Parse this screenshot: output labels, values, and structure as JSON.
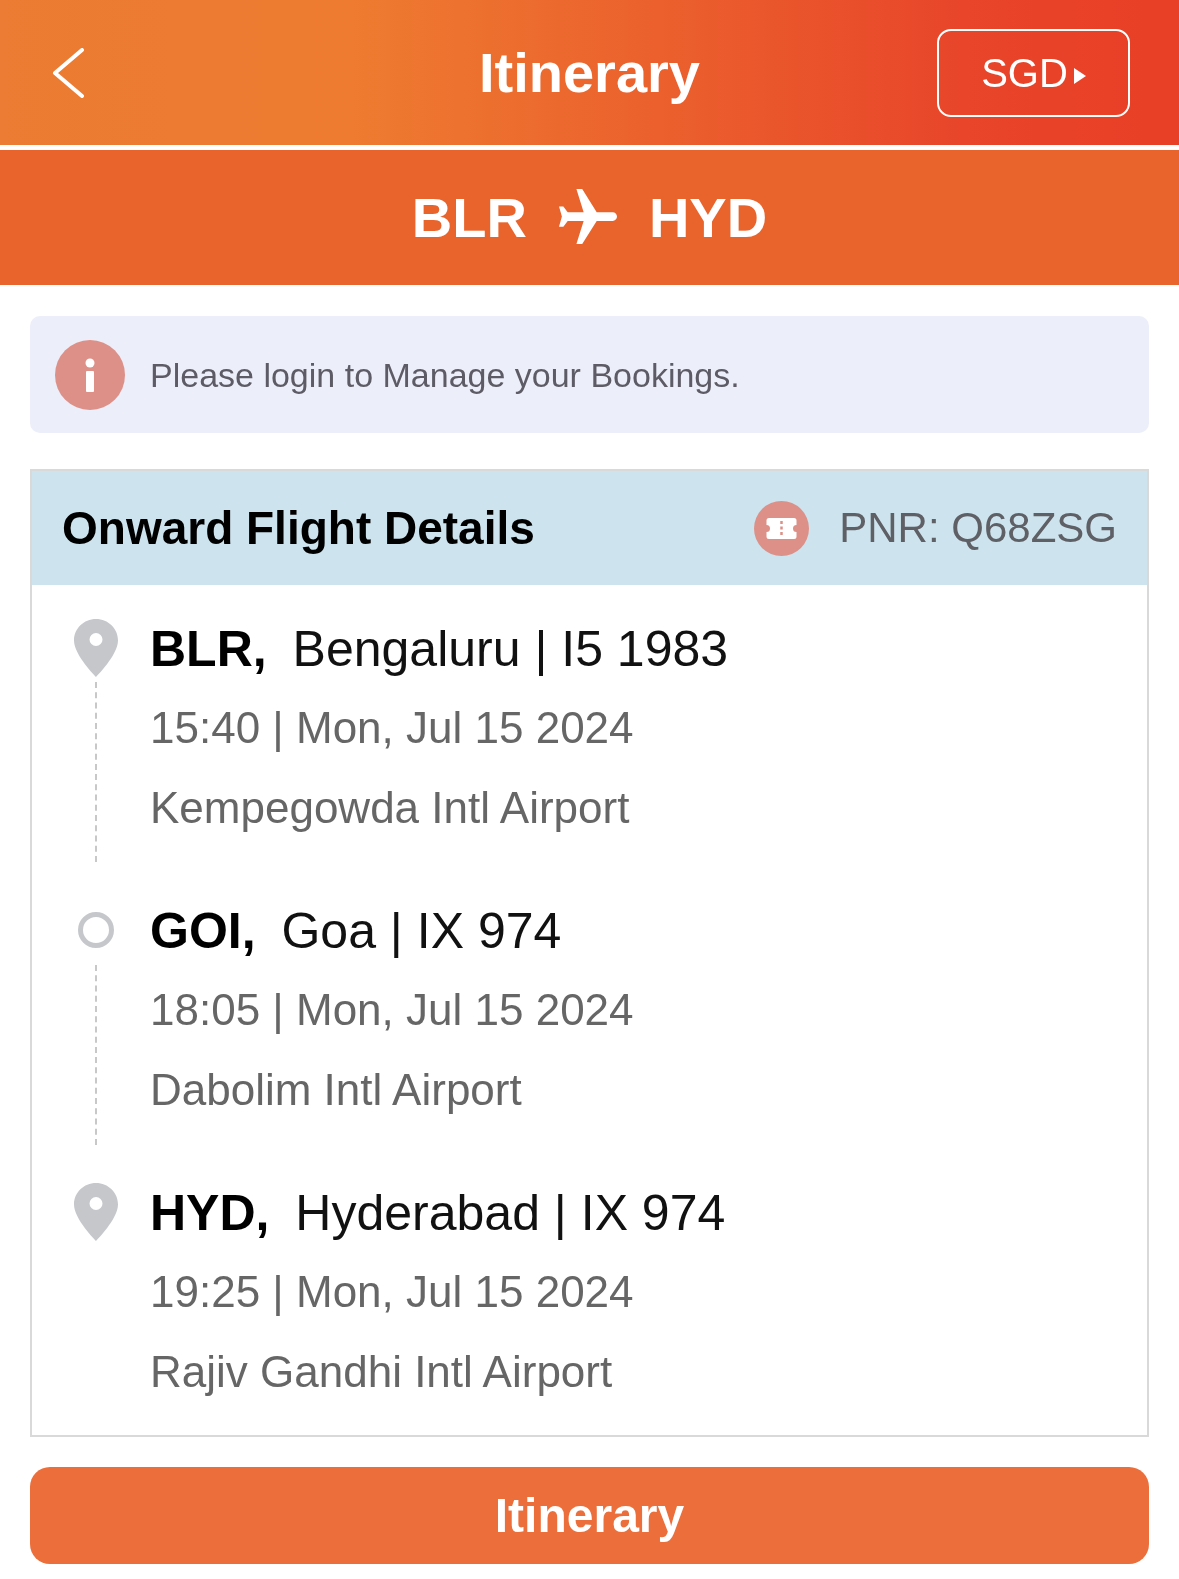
{
  "header": {
    "title": "Itinerary",
    "currency_button": "SGD"
  },
  "route": {
    "origin": "BLR",
    "destination": "HYD"
  },
  "notice": {
    "text": "Please login to Manage your Bookings."
  },
  "flight_card": {
    "title": "Onward Flight Details",
    "pnr": "PNR: Q68ZSG",
    "stops": [
      {
        "kind": "endpoint",
        "title": "**BLR,** Bengaluru | I5 1983",
        "time": "15:40 | Mon, Jul 15 2024",
        "airport": "Kempegowda Intl Airport"
      },
      {
        "kind": "stopover",
        "title": "**GOI,** Goa | IX 974",
        "time": "18:05 | Mon, Jul 15 2024",
        "airport": "Dabolim Intl Airport"
      },
      {
        "kind": "endpoint",
        "title": "**HYD,** Hyderabad | IX 974",
        "time": "19:25 | Mon, Jul 15 2024",
        "airport": "Rajiv Gandhi Intl Airport"
      }
    ]
  },
  "footer_button": {
    "label": "Itinerary"
  }
}
